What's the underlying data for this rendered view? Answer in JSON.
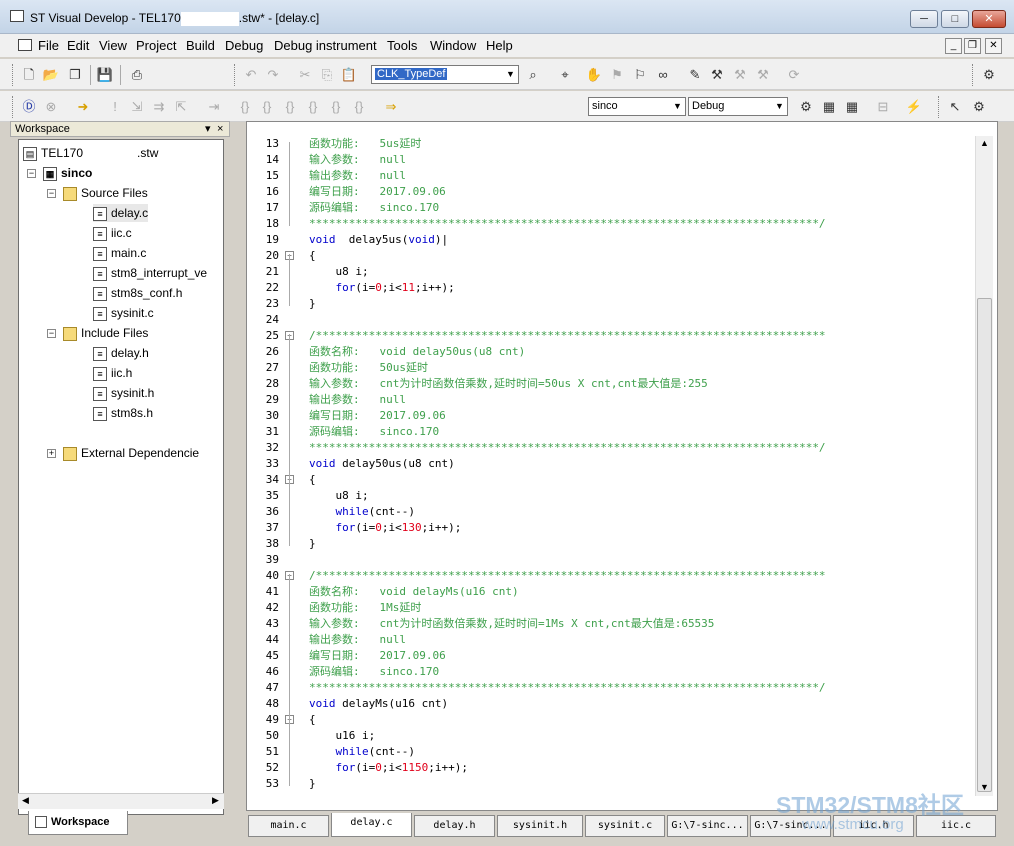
{
  "window": {
    "title_prefix": "ST Visual Develop - TEL170",
    "title_suffix": ".stw* - [delay.c]",
    "min": "─",
    "max": "□",
    "close": "✕"
  },
  "menu": [
    "File",
    "Edit",
    "View",
    "Project",
    "Build",
    "Debug",
    "Debug instrument",
    "Tools",
    "Window",
    "Help"
  ],
  "mdi": {
    "min": "_",
    "restore": "❐",
    "close": "✕"
  },
  "toolbar1": {
    "search_combo": "CLK_TypeDef"
  },
  "toolbar2": {
    "project_combo": "sinco",
    "config_combo": "Debug"
  },
  "workspace": {
    "header": "Workspace",
    "pin": "▾",
    "close": "×",
    "root": "TEL170",
    "root_ext": ".stw",
    "project": "sinco",
    "folders": [
      {
        "name": "Source Files",
        "files": [
          "delay.c",
          "iic.c",
          "main.c",
          "stm8_interrupt_ve",
          "stm8s_conf.h",
          "sysinit.c"
        ]
      },
      {
        "name": "Include Files",
        "files": [
          "delay.h",
          "iic.h",
          "sysinit.h",
          "stm8s.h"
        ]
      },
      {
        "name": "External Dependencie",
        "files": []
      }
    ],
    "tab": "Workspace"
  },
  "editor": {
    "lines": [
      {
        "n": "13",
        "t": [
          [
            "cmt",
            "函数功能:   5us延时"
          ]
        ]
      },
      {
        "n": "14",
        "t": [
          [
            "cmt",
            "输入参数:   null"
          ]
        ]
      },
      {
        "n": "15",
        "t": [
          [
            "cmt",
            "输出参数:   null"
          ]
        ]
      },
      {
        "n": "16",
        "t": [
          [
            "cmt",
            "编写日期:   2017.09.06"
          ]
        ]
      },
      {
        "n": "17",
        "t": [
          [
            "cmt",
            "源码编辑:   sinco.170"
          ]
        ]
      },
      {
        "n": "18",
        "t": [
          [
            "cmt",
            "*****************************************************************************/"
          ]
        ]
      },
      {
        "n": "19",
        "t": [
          [
            "kw",
            "void"
          ],
          [
            "",
            "  delay5us("
          ],
          [
            "kw",
            "void"
          ],
          [
            "",
            ")|"
          ]
        ]
      },
      {
        "n": "20",
        "t": [
          [
            "",
            "{"
          ]
        ]
      },
      {
        "n": "21",
        "t": [
          [
            "",
            "    u8 i;"
          ]
        ]
      },
      {
        "n": "22",
        "t": [
          [
            "",
            "    "
          ],
          [
            "kw",
            "for"
          ],
          [
            "",
            "(i="
          ],
          [
            "num",
            "0"
          ],
          [
            "",
            ";i<"
          ],
          [
            "num",
            "11"
          ],
          [
            "",
            ";i++);"
          ]
        ]
      },
      {
        "n": "23",
        "t": [
          [
            "",
            "}"
          ]
        ]
      },
      {
        "n": "24",
        "t": [
          [
            "",
            ""
          ]
        ]
      },
      {
        "n": "25",
        "t": [
          [
            "cmt",
            "/*****************************************************************************"
          ]
        ]
      },
      {
        "n": "26",
        "t": [
          [
            "cmt",
            "函数名称:   void delay50us(u8 cnt)"
          ]
        ]
      },
      {
        "n": "27",
        "t": [
          [
            "cmt",
            "函数功能:   50us延时"
          ]
        ]
      },
      {
        "n": "28",
        "t": [
          [
            "cmt",
            "输入参数:   cnt为计时函数倍乘数,延时时间=50us X cnt,cnt最大值是:255"
          ]
        ]
      },
      {
        "n": "29",
        "t": [
          [
            "cmt",
            "输出参数:   null"
          ]
        ]
      },
      {
        "n": "30",
        "t": [
          [
            "cmt",
            "编写日期:   2017.09.06"
          ]
        ]
      },
      {
        "n": "31",
        "t": [
          [
            "cmt",
            "源码编辑:   sinco.170"
          ]
        ]
      },
      {
        "n": "32",
        "t": [
          [
            "cmt",
            "*****************************************************************************/"
          ]
        ]
      },
      {
        "n": "33",
        "t": [
          [
            "kw",
            "void"
          ],
          [
            "",
            " delay50us(u8 cnt)"
          ]
        ]
      },
      {
        "n": "34",
        "t": [
          [
            "",
            "{"
          ]
        ]
      },
      {
        "n": "35",
        "t": [
          [
            "",
            "    u8 i;"
          ]
        ]
      },
      {
        "n": "36",
        "t": [
          [
            "",
            "    "
          ],
          [
            "kw",
            "while"
          ],
          [
            "",
            "(cnt--)"
          ]
        ]
      },
      {
        "n": "37",
        "t": [
          [
            "",
            "    "
          ],
          [
            "kw",
            "for"
          ],
          [
            "",
            "(i="
          ],
          [
            "num",
            "0"
          ],
          [
            "",
            ";i<"
          ],
          [
            "num",
            "130"
          ],
          [
            "",
            ";i++);"
          ]
        ]
      },
      {
        "n": "38",
        "t": [
          [
            "",
            "}"
          ]
        ]
      },
      {
        "n": "39",
        "t": [
          [
            "",
            ""
          ]
        ]
      },
      {
        "n": "40",
        "t": [
          [
            "cmt",
            "/*****************************************************************************"
          ]
        ]
      },
      {
        "n": "41",
        "t": [
          [
            "cmt",
            "函数名称:   void delayMs(u16 cnt)"
          ]
        ]
      },
      {
        "n": "42",
        "t": [
          [
            "cmt",
            "函数功能:   1Ms延时"
          ]
        ]
      },
      {
        "n": "43",
        "t": [
          [
            "cmt",
            "输入参数:   cnt为计时函数倍乘数,延时时间=1Ms X cnt,cnt最大值是:65535"
          ]
        ]
      },
      {
        "n": "44",
        "t": [
          [
            "cmt",
            "输出参数:   null"
          ]
        ]
      },
      {
        "n": "45",
        "t": [
          [
            "cmt",
            "编写日期:   2017.09.06"
          ]
        ]
      },
      {
        "n": "46",
        "t": [
          [
            "cmt",
            "源码编辑:   sinco.170"
          ]
        ]
      },
      {
        "n": "47",
        "t": [
          [
            "cmt",
            "*****************************************************************************/"
          ]
        ]
      },
      {
        "n": "48",
        "t": [
          [
            "kw",
            "void"
          ],
          [
            "",
            " delayMs(u16 cnt)"
          ]
        ]
      },
      {
        "n": "49",
        "t": [
          [
            "",
            "{"
          ]
        ]
      },
      {
        "n": "50",
        "t": [
          [
            "",
            "    u16 i;"
          ]
        ]
      },
      {
        "n": "51",
        "t": [
          [
            "",
            "    "
          ],
          [
            "kw",
            "while"
          ],
          [
            "",
            "(cnt--)"
          ]
        ]
      },
      {
        "n": "52",
        "t": [
          [
            "",
            "    "
          ],
          [
            "kw",
            "for"
          ],
          [
            "",
            "(i="
          ],
          [
            "num",
            "0"
          ],
          [
            "",
            ";i<"
          ],
          [
            "num",
            "1150"
          ],
          [
            "",
            ";i++);"
          ]
        ]
      },
      {
        "n": "53",
        "t": [
          [
            "",
            "}"
          ]
        ]
      }
    ],
    "fold_markers": [
      "20",
      "25",
      "34",
      "40",
      "49"
    ]
  },
  "file_tabs": [
    "main.c",
    "delay.c",
    "delay.h",
    "sysinit.h",
    "sysinit.c",
    "G:\\7-sinc...",
    "G:\\7-sinc...",
    "iic.h",
    "iic.c"
  ],
  "active_tab": "delay.c",
  "watermark": {
    "line1": "STM32/STM8社区",
    "line2": "www.stmcu.org"
  }
}
